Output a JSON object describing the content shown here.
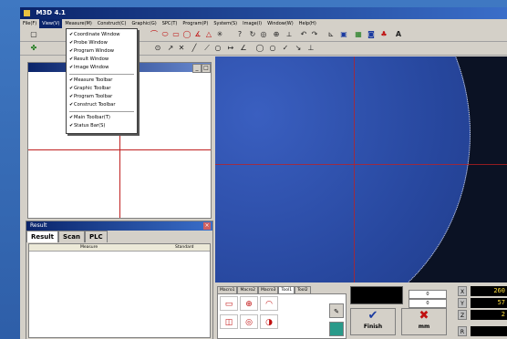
{
  "app": {
    "title": "M3D 4.1"
  },
  "menu": [
    "File(F)",
    "View(V)",
    "Measure(M)",
    "Construct(C)",
    "Graphic(G)",
    "SPC(T)",
    "Program(P)",
    "System(S)",
    "Image(I)",
    "Window(W)",
    "Help(H)"
  ],
  "view_menu": {
    "group1": [
      "Coordinate Window",
      "Probe Window",
      "Program Window",
      "Result Window",
      "Image Window"
    ],
    "group2": [
      "Measure Toolbar",
      "Graphic Toolbar",
      "Program Toolbar",
      "Construct Toolbar"
    ],
    "group3": [
      "Main Toolbar(T)",
      "Status Bar(S)"
    ]
  },
  "results_panel": {
    "title": "Result",
    "tabs": [
      "Result",
      "Scan",
      "PLC"
    ],
    "columns": [
      "Measure",
      "Standard"
    ]
  },
  "macro": {
    "tabs": [
      "Macro1",
      "Macro2",
      "Macro3",
      "Tool1",
      "Tool2"
    ]
  },
  "spinners": [
    "0",
    "0"
  ],
  "buttons": {
    "finish": "Finish",
    "unit": "mm"
  },
  "axes": [
    "X",
    "Y",
    "Z",
    "R"
  ],
  "dro_values": [
    "260",
    "57",
    "2",
    ""
  ],
  "colors": {
    "title_bar": "#0a246a",
    "camera_part": "#2a4aa8",
    "crosshair": "#c02020",
    "dro_text": "#ffe040"
  }
}
